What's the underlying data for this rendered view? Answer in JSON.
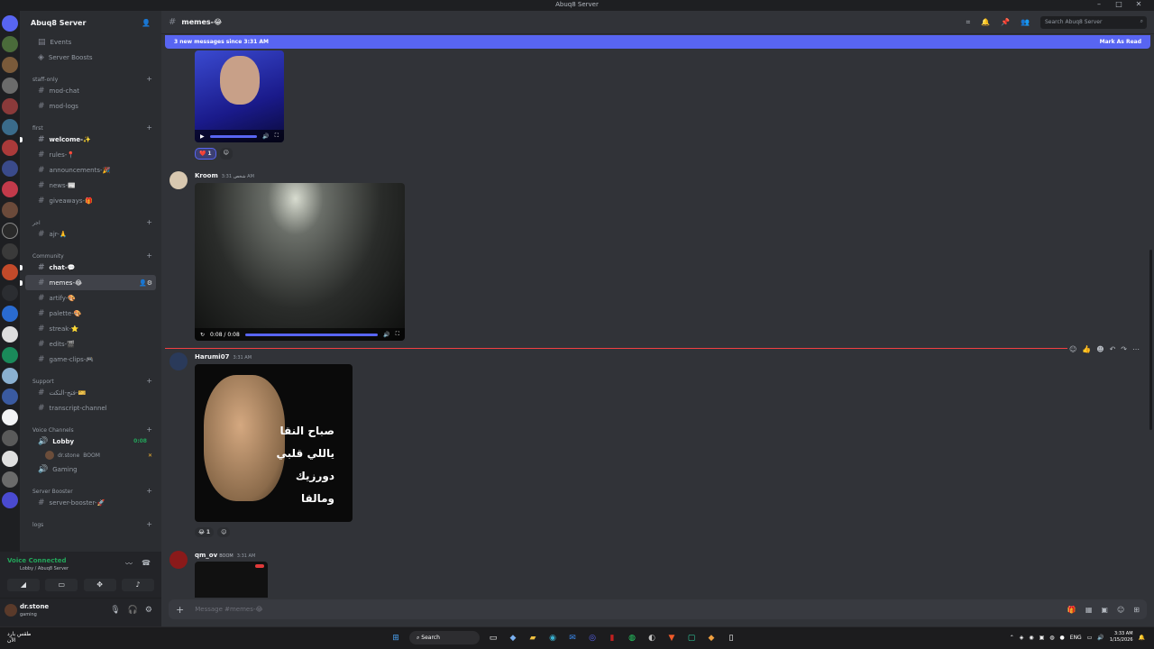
{
  "window": {
    "title": "Abuq8 Server"
  },
  "server_name": "Abuq8 Server",
  "top_items": [
    {
      "label": "Events",
      "icon": "calendar-icon"
    },
    {
      "label": "Server Boosts",
      "icon": "boost-icon"
    }
  ],
  "categories": {
    "staff": "staff-only",
    "first": "first",
    "ajr_cat": "اجر",
    "community": "Community",
    "support": "Support",
    "voice": "Voice Channels",
    "booster": "Server Booster",
    "logs": "logs"
  },
  "channels": {
    "mod_chat": "mod-chat",
    "mod_logs": "mod-logs",
    "welcome": "welcome-✨",
    "rules": "rules-📍",
    "announcements": "announcements-🎉",
    "news": "news-📰",
    "giveaways": "giveaways-🎁",
    "ajr": "ajr-🙏",
    "chat": "chat-💬",
    "memes": "memes-😂",
    "artify": "artify-🎨",
    "palette": "palette-🎨",
    "streak": "streak-⭐",
    "edits": "edits-🎬",
    "game_clips": "game-clips-🎮",
    "open_ticket": "فتح-التكت-🎫",
    "transcript": "transcript-channel",
    "server_booster": "server-booster-🚀"
  },
  "voice": {
    "lobby": "Lobby",
    "lobby_time": "0:08",
    "user": "dr.stone",
    "user_tag": "BOOM",
    "gaming": "Gaming"
  },
  "voice_panel": {
    "status": "Voice Connected",
    "location": "Lobby / Abuq8 Server"
  },
  "user_panel": {
    "name": "dr.stone",
    "status": "gaming"
  },
  "header": {
    "channel": "memes-😂",
    "search_placeholder": "Search Abuq8 Server"
  },
  "new_messages": {
    "text": "3 new messages since 3:31 AM",
    "mark": "Mark As Read"
  },
  "messages": [
    {
      "user": "Kroom",
      "tag": "شخص",
      "time": "3:31 AM",
      "video_time": "0:08 / 0:08"
    },
    {
      "user": "Harumi07",
      "time": "3:31 AM",
      "caption_lines": [
        "صباح النقا",
        "ياللي قلبي",
        "دورزيك",
        "ومالقا"
      ],
      "reaction_count": "1"
    },
    {
      "user": "qm_ov",
      "tag": "BOOM",
      "time": "3:31 AM"
    }
  ],
  "first_reaction_count": "1",
  "composer": {
    "placeholder": "Message #memes-😂"
  },
  "taskbar": {
    "weather_line1": "طقس بارد",
    "weather_line2": "الآن",
    "search": "Search",
    "lang": "ENG",
    "time": "3:33 AM",
    "date": "1/15/2026"
  },
  "colors": {
    "accent": "#5865f2",
    "unread": "#f23f42",
    "online": "#23a55a"
  }
}
